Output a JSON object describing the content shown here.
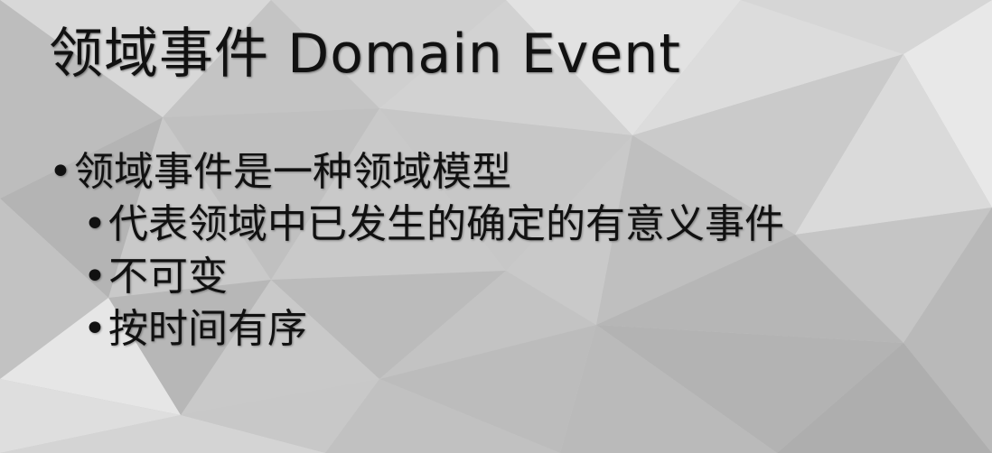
{
  "slide": {
    "title": "领域事件 Domain Event",
    "bullet_glyph": "•",
    "bullets": [
      {
        "text": "领域事件是一种领域模型",
        "children": [
          {
            "text": "代表领域中已发生的确定的有意义事件"
          },
          {
            "text": "不可变"
          },
          {
            "text": "按时间有序"
          }
        ]
      }
    ]
  }
}
